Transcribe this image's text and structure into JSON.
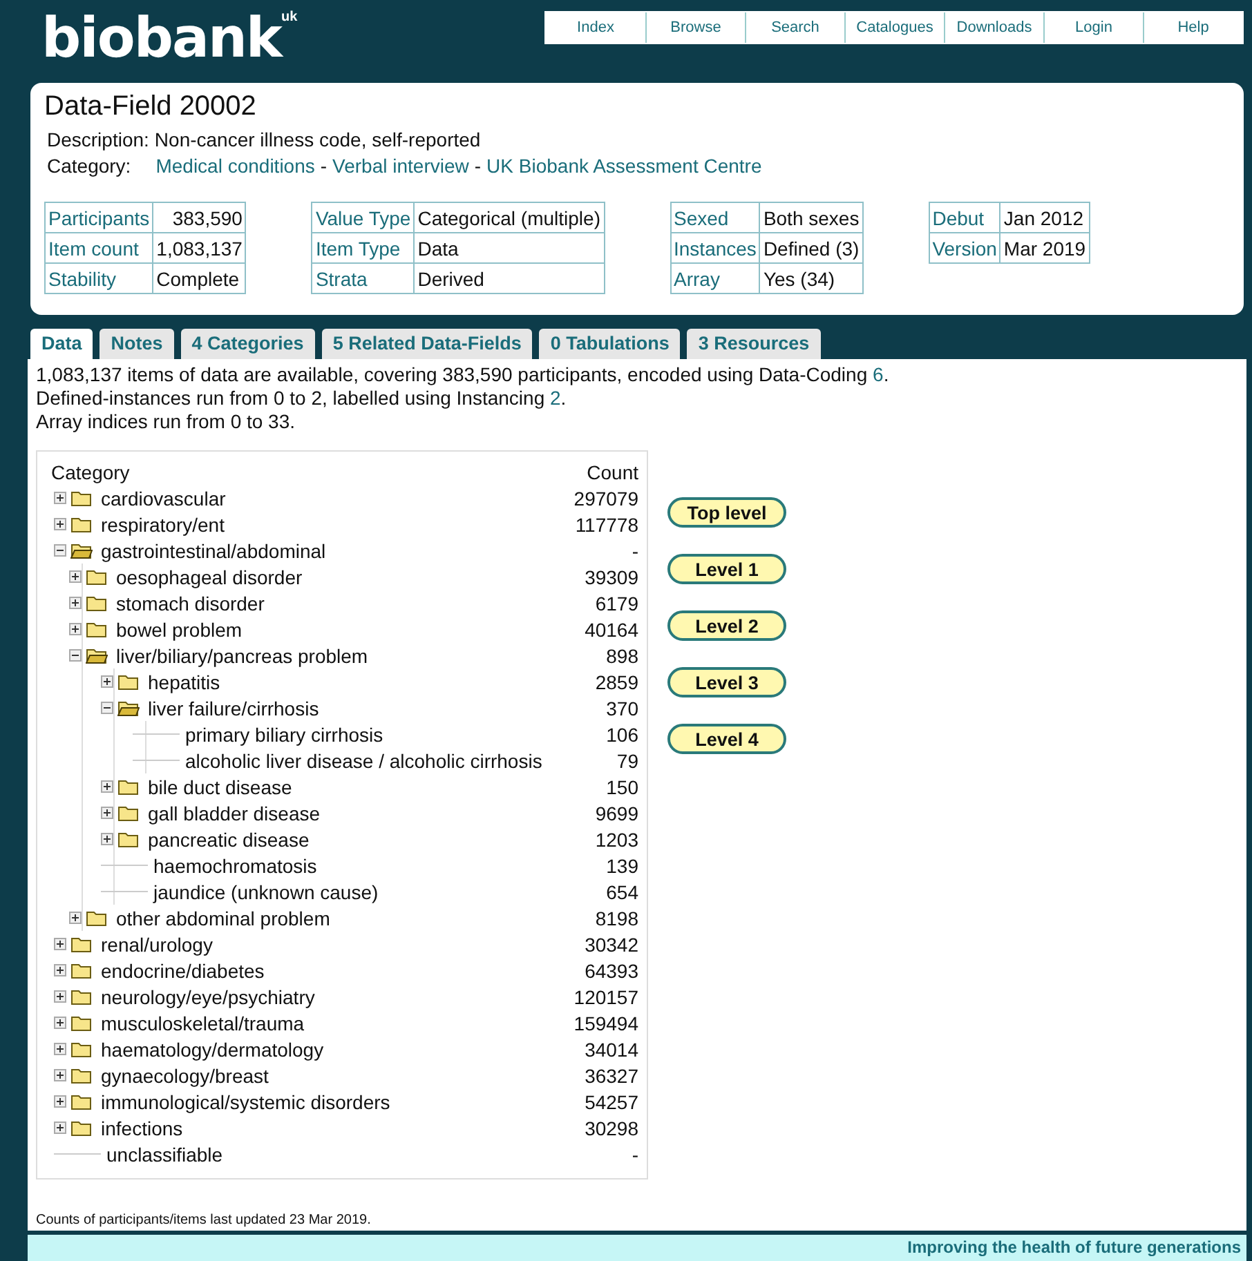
{
  "logo": {
    "text": "biobank",
    "sup": "uk"
  },
  "nav": [
    {
      "label": "Index"
    },
    {
      "label": "Browse"
    },
    {
      "label": "Search"
    },
    {
      "label": "Catalogues"
    },
    {
      "label": "Downloads"
    },
    {
      "label": "Login"
    },
    {
      "label": "Help"
    }
  ],
  "field": {
    "title": "Data-Field 20002",
    "description_label": "Description:",
    "description": "Non-cancer illness code, self-reported",
    "category_label": "Category:",
    "category_links": [
      "Medical conditions",
      "Verbal interview",
      "UK Biobank Assessment Centre"
    ],
    "separator": "-"
  },
  "info_tables": [
    {
      "rows": [
        {
          "label": "Participants",
          "value": "383,590"
        },
        {
          "label": "Item count",
          "value": "1,083,137"
        },
        {
          "label": "Stability",
          "value": "Complete"
        }
      ]
    },
    {
      "rows": [
        {
          "label": "Value Type",
          "value": "Categorical (multiple)"
        },
        {
          "label": "Item Type",
          "value": "Data"
        },
        {
          "label": "Strata",
          "value": "Derived"
        }
      ]
    },
    {
      "rows": [
        {
          "label": "Sexed",
          "value": "Both sexes"
        },
        {
          "label": "Instances",
          "value": "Defined (3)"
        },
        {
          "label": "Array",
          "value": "Yes (34)"
        }
      ]
    },
    {
      "rows": [
        {
          "label": "Debut",
          "value": "Jan 2012"
        },
        {
          "label": "Version",
          "value": "Mar 2019"
        }
      ]
    }
  ],
  "tabs": [
    {
      "label": "Data",
      "selected": true
    },
    {
      "label": "Notes",
      "selected": false
    },
    {
      "label": "4 Categories",
      "selected": false
    },
    {
      "label": "5 Related Data-Fields",
      "selected": false
    },
    {
      "label": "0 Tabulations",
      "selected": false
    },
    {
      "label": "3 Resources",
      "selected": false
    }
  ],
  "summary": [
    {
      "text": "1,083,137 items of data are available, covering 383,590 participants, encoded using Data-Coding ",
      "link": "6",
      "after": "."
    },
    {
      "text": "Defined-instances run from 0 to 2, labelled using Instancing ",
      "link": "2",
      "after": "."
    },
    {
      "text": "Array indices run from 0 to 33."
    }
  ],
  "tree": {
    "columns": [
      "Category",
      "Count"
    ],
    "items": [
      {
        "label": "cardiovascular",
        "count": "297079",
        "expanded": false
      },
      {
        "label": "respiratory/ent",
        "count": "117778",
        "expanded": false
      },
      {
        "label": "gastrointestinal/abdominal",
        "count": "-",
        "expanded": true,
        "children": [
          {
            "label": "oesophageal disorder",
            "count": "39309",
            "expanded": false
          },
          {
            "label": "stomach disorder",
            "count": "6179",
            "expanded": false
          },
          {
            "label": "bowel problem",
            "count": "40164",
            "expanded": false
          },
          {
            "label": "liver/biliary/pancreas problem",
            "count": "898",
            "expanded": true,
            "children": [
              {
                "label": "hepatitis",
                "count": "2859",
                "expanded": false
              },
              {
                "label": "liver failure/cirrhosis",
                "count": "370",
                "expanded": true,
                "children": [
                  {
                    "label": "primary biliary cirrhosis",
                    "count": "106"
                  },
                  {
                    "label": "alcoholic liver disease / alcoholic cirrhosis",
                    "count": "79"
                  }
                ]
              },
              {
                "label": "bile duct disease",
                "count": "150",
                "expanded": false
              },
              {
                "label": "gall bladder disease",
                "count": "9699",
                "expanded": false
              },
              {
                "label": "pancreatic disease",
                "count": "1203",
                "expanded": false
              },
              {
                "label": "haemochromatosis",
                "count": "139"
              },
              {
                "label": "jaundice (unknown cause)",
                "count": "654"
              }
            ]
          },
          {
            "label": "other abdominal problem",
            "count": "8198",
            "expanded": false
          }
        ]
      },
      {
        "label": "renal/urology",
        "count": "30342",
        "expanded": false
      },
      {
        "label": "endocrine/diabetes",
        "count": "64393",
        "expanded": false
      },
      {
        "label": "neurology/eye/psychiatry",
        "count": "120157",
        "expanded": false
      },
      {
        "label": "musculoskeletal/trauma",
        "count": "159494",
        "expanded": false
      },
      {
        "label": "haematology/dermatology",
        "count": "34014",
        "expanded": false
      },
      {
        "label": "gynaecology/breast",
        "count": "36327",
        "expanded": false
      },
      {
        "label": "immunological/systemic disorders",
        "count": "54257",
        "expanded": false
      },
      {
        "label": "infections",
        "count": "30298",
        "expanded": false
      },
      {
        "label": "unclassifiable",
        "count": "-"
      }
    ]
  },
  "level_buttons": [
    "Top level",
    "Level 1",
    "Level 2",
    "Level 3",
    "Level 4"
  ],
  "note": "Counts of participants/items last updated 23 Mar 2019.",
  "footer": "Improving the health of future generations"
}
